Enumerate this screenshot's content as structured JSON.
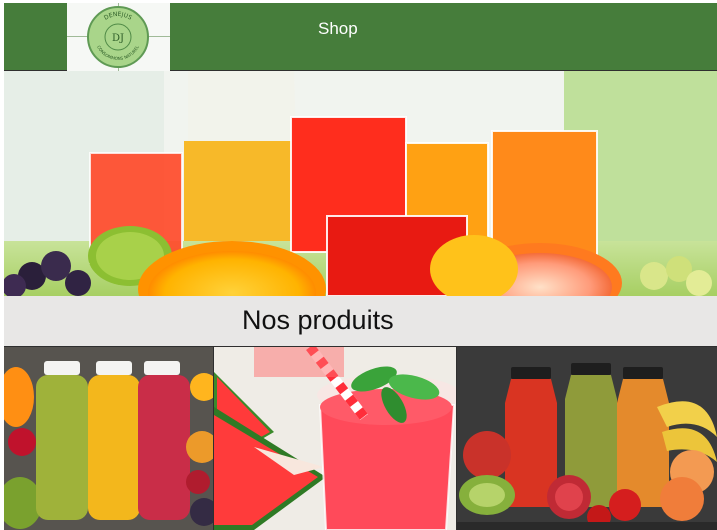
{
  "header": {
    "logo_text_top": "DENEJUS",
    "logo_text_bottom": "CONSOMMONS NATUREL",
    "logo_initials": "DJ",
    "nav_shop": "Shop"
  },
  "hero": {
    "image": "juice-glasses-with-citrus-fruits"
  },
  "products_section": {
    "title": "Nos produits",
    "items": [
      {
        "image": "bottled-juices-green-yellow-red"
      },
      {
        "image": "watermelon-smoothie-glass"
      },
      {
        "image": "bottled-juices-with-fruits"
      }
    ]
  },
  "colors": {
    "header_bg": "#467d3b",
    "section_bar_bg": "#e8e7e6"
  }
}
